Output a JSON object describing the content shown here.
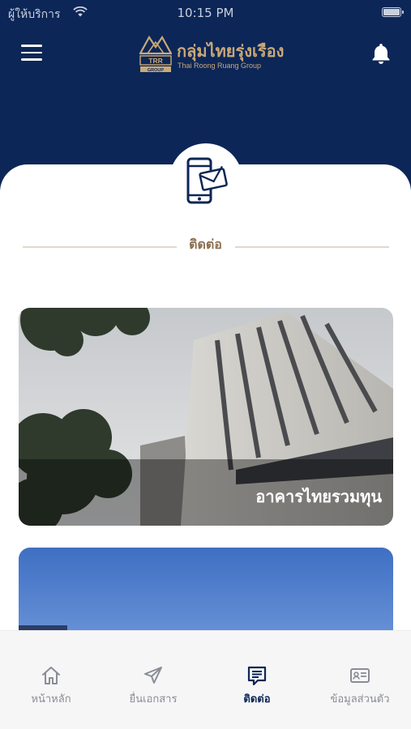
{
  "status_bar": {
    "carrier": "ผู้ให้บริการ",
    "time": "10:15 PM",
    "wifi_icon": "wifi-icon",
    "battery_level": 1.0
  },
  "header": {
    "menu_icon": "hamburger-menu-icon",
    "notification_icon": "bell-icon",
    "logo": {
      "mark_text": "TRR",
      "mark_subtext": "GROUP",
      "name_thai": "กลุ่มไทยรุ่งเรือง",
      "name_en": "Thai Roong Ruang Group"
    }
  },
  "section": {
    "icon": "phone-mail-icon",
    "title": "ติดต่อ"
  },
  "cards": [
    {
      "label": "อาคารไทยรวมทุน"
    },
    {
      "label": ""
    }
  ],
  "tabs": [
    {
      "label": "หน้าหลัก",
      "icon": "home-icon",
      "active": false
    },
    {
      "label": "ยื่นเอกสาร",
      "icon": "send-icon",
      "active": false
    },
    {
      "label": "ติดต่อ",
      "icon": "message-icon",
      "active": true
    },
    {
      "label": "ข้อมูลส่วนตัว",
      "icon": "id-card-icon",
      "active": false
    }
  ],
  "colors": {
    "header_bg": "#0c2657",
    "gold": "#c9a978",
    "title_brown": "#8b7050",
    "tab_active": "#0c2657",
    "tab_inactive": "#8a8d95"
  }
}
